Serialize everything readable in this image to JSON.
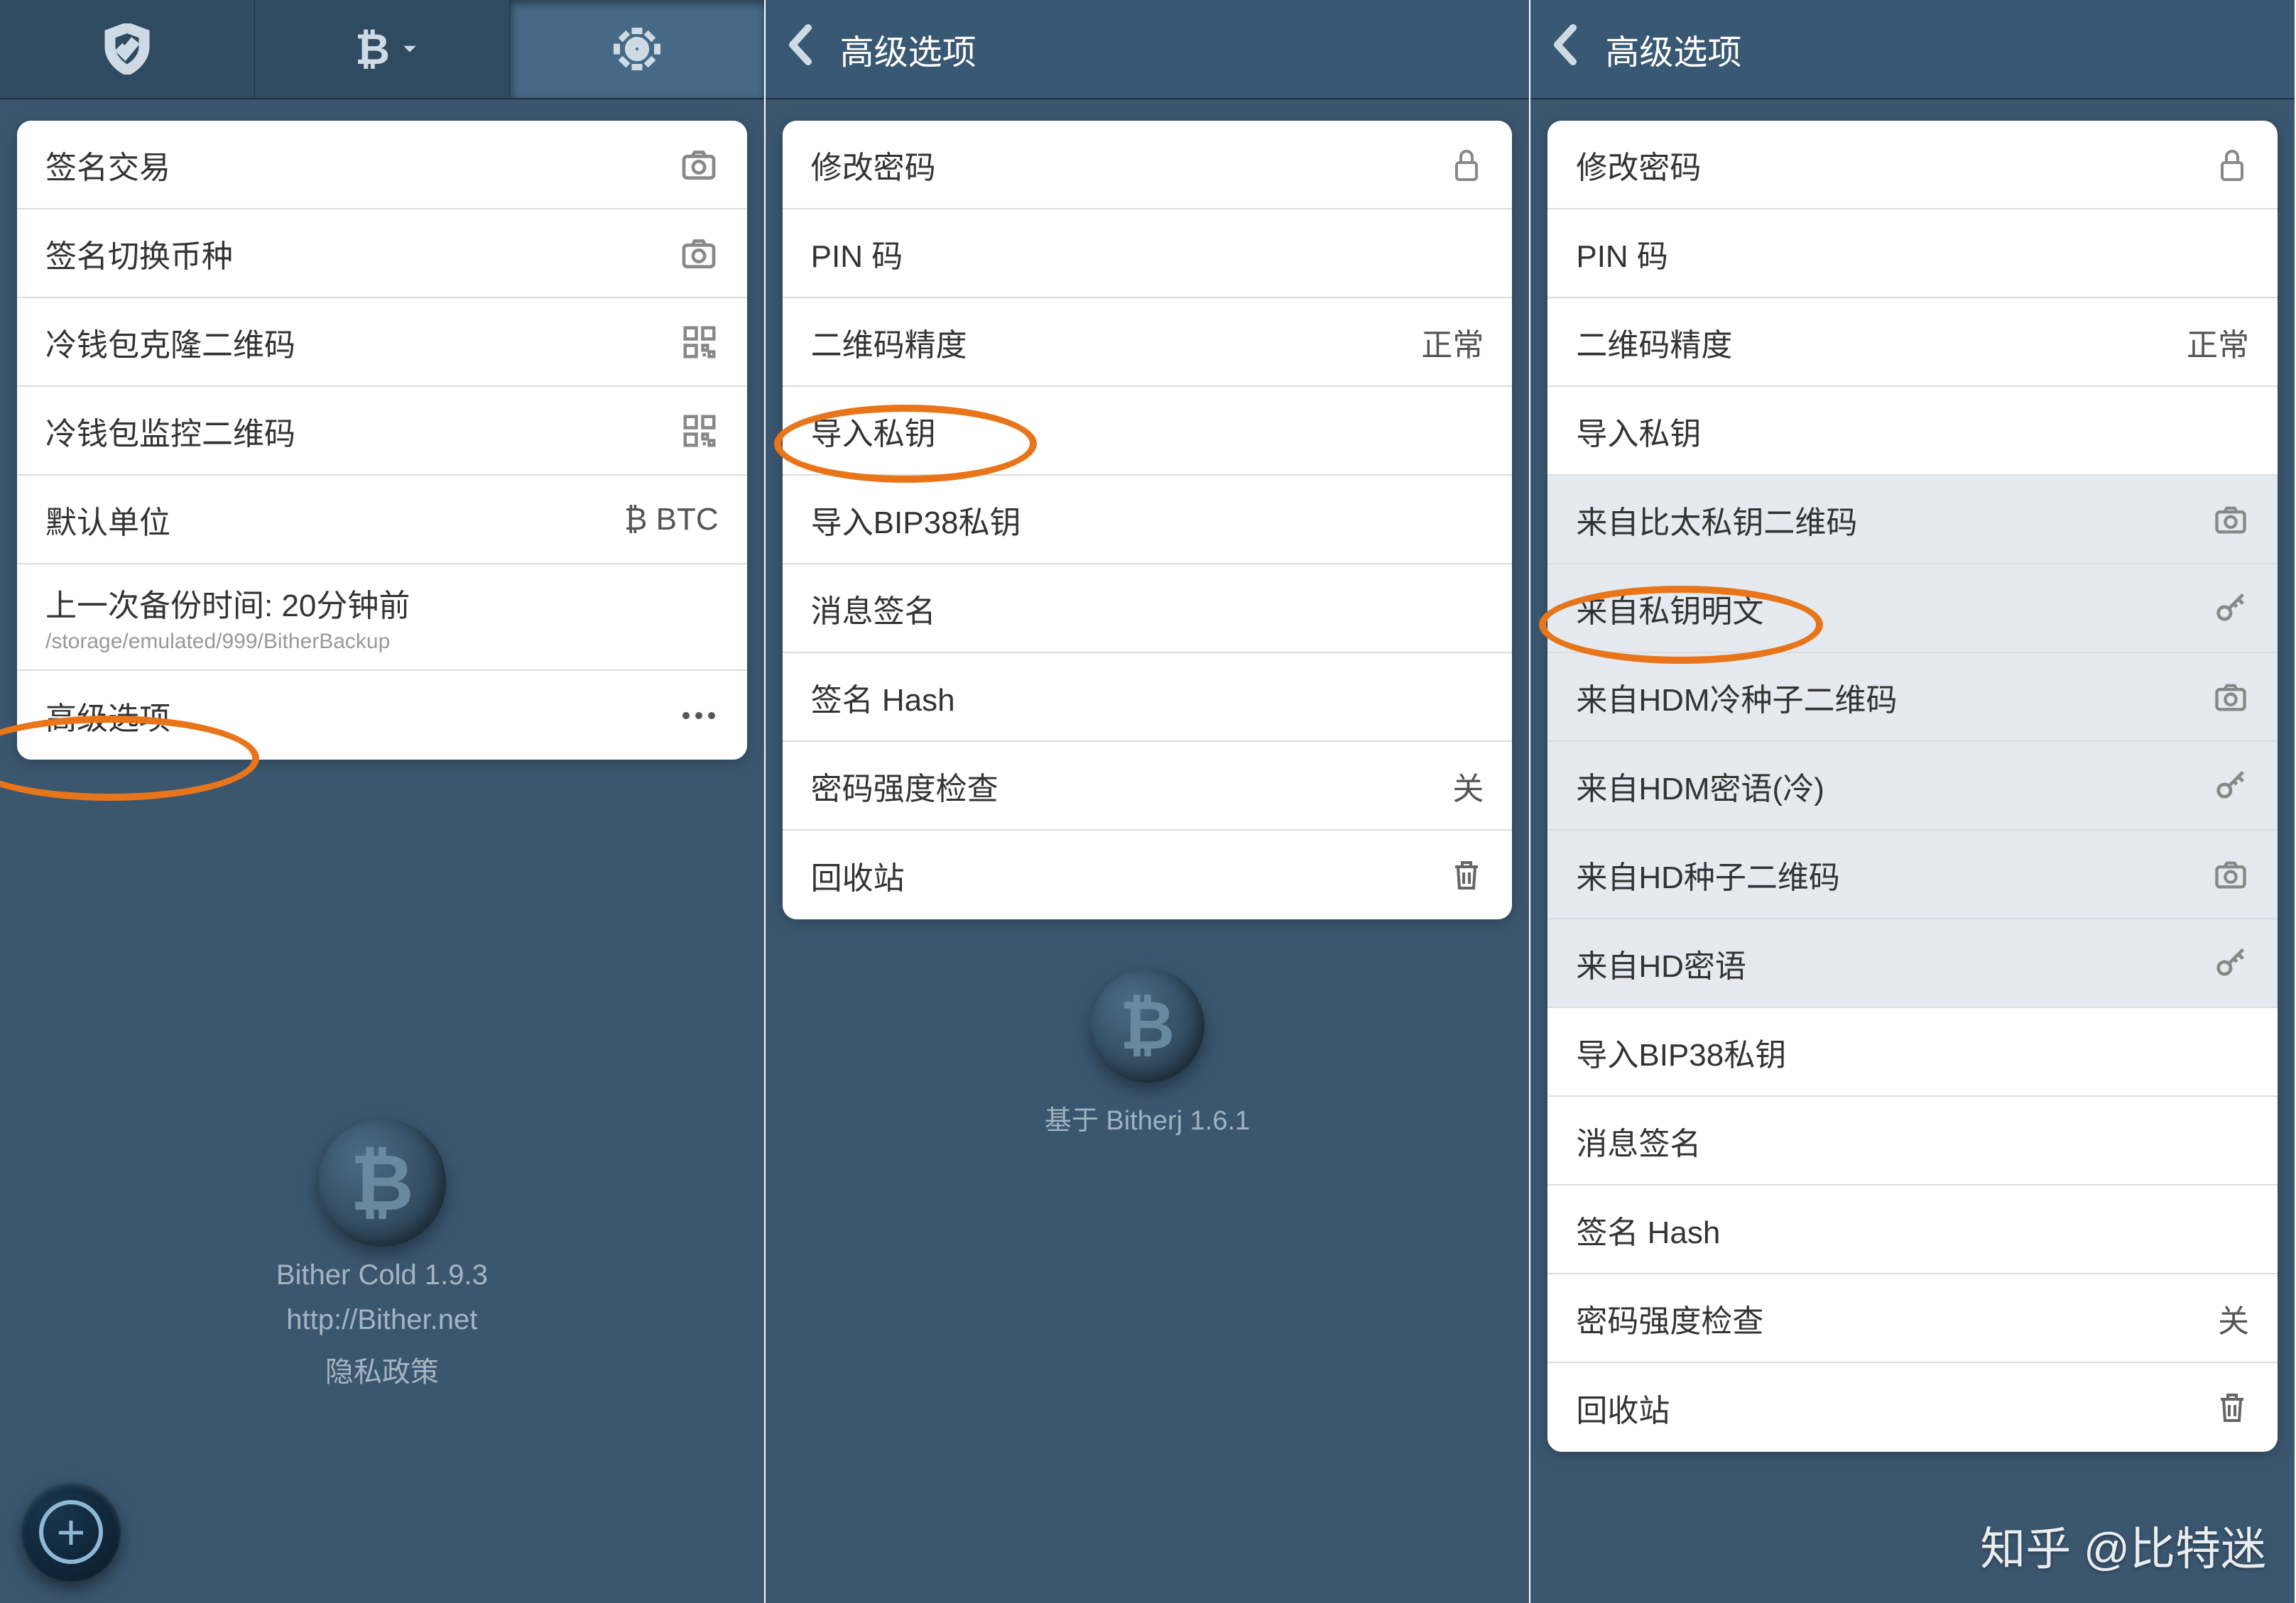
{
  "pane1": {
    "rows": [
      {
        "label": "签名交易",
        "icon": "camera"
      },
      {
        "label": "签名切换币种",
        "icon": "camera"
      },
      {
        "label": "冷钱包克隆二维码",
        "icon": "qr"
      },
      {
        "label": "冷钱包监控二维码",
        "icon": "qr"
      },
      {
        "label": "默认单位",
        "value": "₿ BTC"
      },
      {
        "label": "上一次备份时间: 20分钟前",
        "sub": "/storage/emulated/999/BitherBackup"
      },
      {
        "label": "高级选项",
        "icon": "more"
      }
    ],
    "footer": {
      "app": "Bither Cold 1.9.3",
      "url": "http://Bither.net",
      "privacy": "隐私政策"
    }
  },
  "pane2": {
    "title": "高级选项",
    "rows": [
      {
        "label": "修改密码",
        "icon": "lock"
      },
      {
        "label": "PIN 码"
      },
      {
        "label": "二维码精度",
        "value": "正常"
      },
      {
        "label": "导入私钥"
      },
      {
        "label": "导入BIP38私钥"
      },
      {
        "label": "消息签名"
      },
      {
        "label": "签名 Hash"
      },
      {
        "label": "密码强度检查",
        "value": "关"
      },
      {
        "label": "回收站",
        "icon": "trash"
      }
    ],
    "footer": "基于  Bitherj 1.6.1"
  },
  "pane3": {
    "title": "高级选项",
    "rows": [
      {
        "label": "修改密码",
        "icon": "lock"
      },
      {
        "label": "PIN 码"
      },
      {
        "label": "二维码精度",
        "value": "正常"
      },
      {
        "label": "导入私钥"
      },
      {
        "label": "来自比太私钥二维码",
        "icon": "camera",
        "sub": true
      },
      {
        "label": "来自私钥明文",
        "icon": "key",
        "sub": true
      },
      {
        "label": "来自HDM冷种子二维码",
        "icon": "camera",
        "sub": true
      },
      {
        "label": "来自HDM密语(冷)",
        "icon": "key",
        "sub": true
      },
      {
        "label": "来自HD种子二维码",
        "icon": "camera",
        "sub": true
      },
      {
        "label": "来自HD密语",
        "icon": "key",
        "sub": true
      },
      {
        "label": "导入BIP38私钥"
      },
      {
        "label": "消息签名"
      },
      {
        "label": "签名 Hash"
      },
      {
        "label": "密码强度检查",
        "value": "关"
      },
      {
        "label": "回收站",
        "icon": "trash"
      }
    ]
  },
  "watermark": "知乎 @比特迷"
}
